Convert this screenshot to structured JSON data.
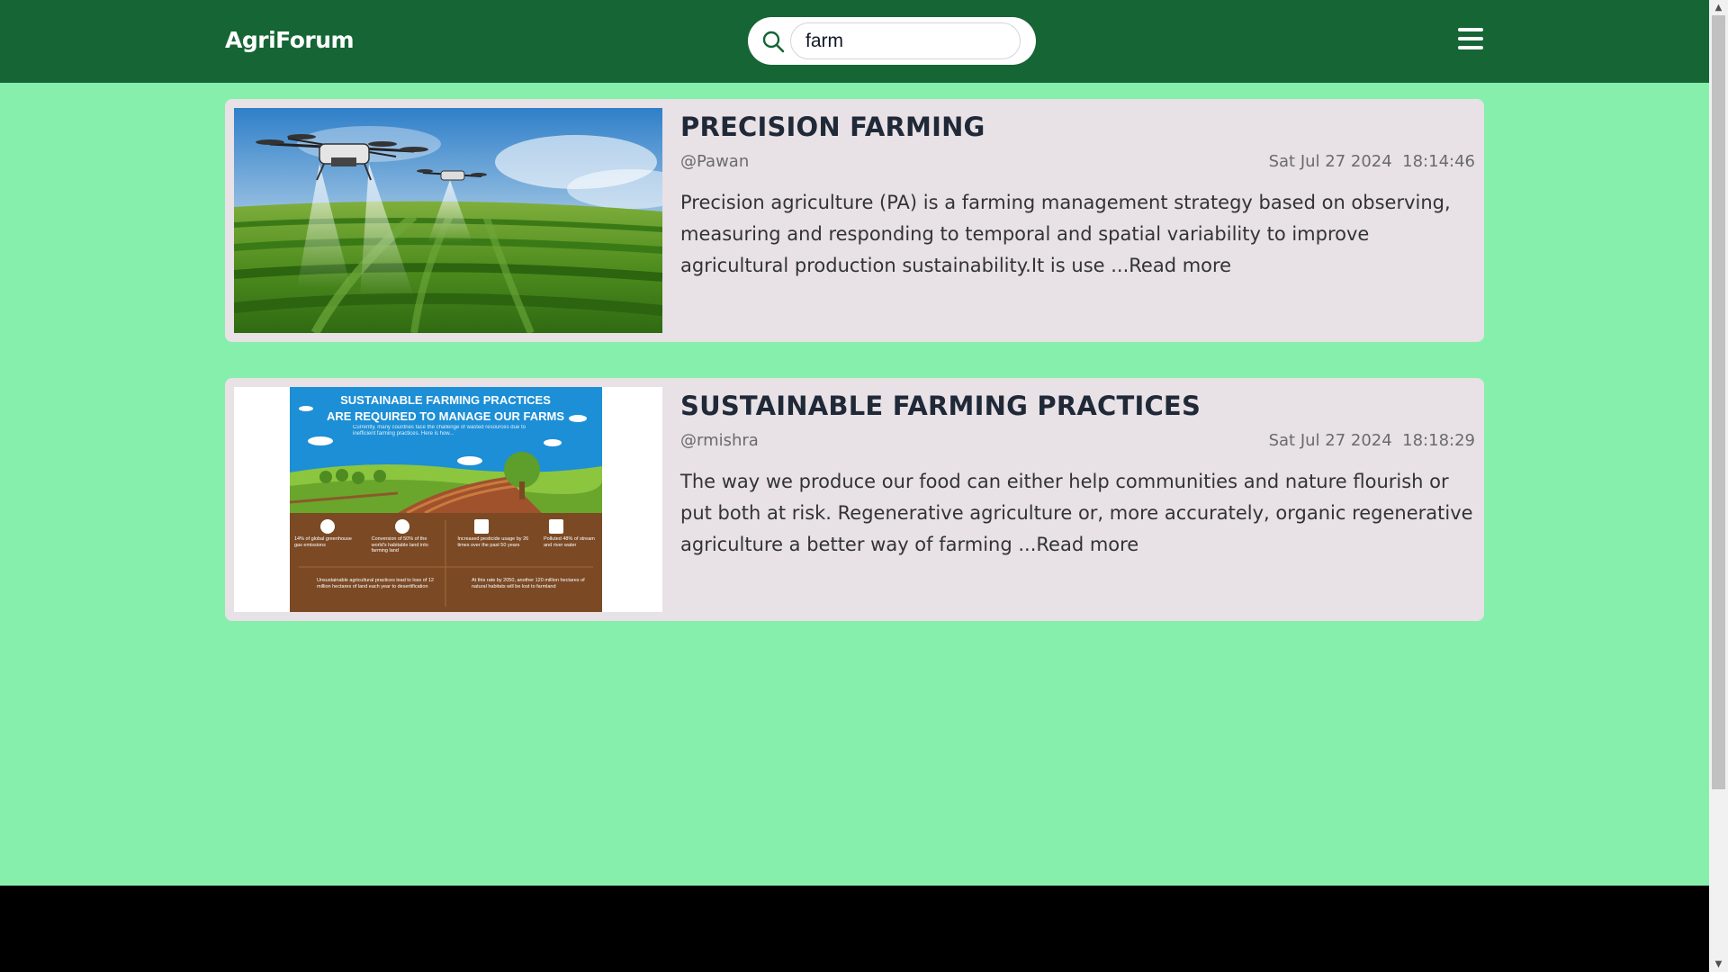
{
  "brand": "AgriForum",
  "search": {
    "value": "farm"
  },
  "posts": [
    {
      "title": "PRECISION FARMING",
      "author": "@Pawan",
      "date": "Sat Jul 27 2024",
      "time": "18:14:46",
      "excerpt": "Precision agriculture (PA) is a farming management strategy based on observing, measuring and responding to temporal and spatial variability to improve agricultural production sustainability.It is use ",
      "read_more": "...Read more"
    },
    {
      "title": "SUSTAINABLE FARMING PRACTICES",
      "author": "@rmishra",
      "date": "Sat Jul 27 2024",
      "time": "18:18:29",
      "excerpt": "The way we produce our food can either help communities and nature flourish or put both at risk. Regenerative agriculture or, more accurately, organic regenerative agriculture a better way of farming ",
      "read_more": "...Read more",
      "infographic": {
        "heading_line1": "SUSTAINABLE FARMING PRACTICES",
        "heading_line2": "ARE REQUIRED TO MANAGE OUR FARMS",
        "subheading": "Currently, many countries face the challenge of wasted resources due to inefficient farming practices. Here is how...",
        "stats": [
          {
            "text": "14% of global greenhouse gas emissions"
          },
          {
            "text": "Conversion of 50% of the world's habitable land into farming land"
          },
          {
            "text": "Increased pesticide usage by 26 times over the past 50 years"
          },
          {
            "text": "Polluted 48% of stream and river water"
          }
        ],
        "bottom_left": "Unsustainable agricultural practices lead to loss of 12 million hectares of land each year to desertification",
        "bottom_right": "At this rate by 2050, another 120 million hectares of natural habitats will be lost to farmland"
      }
    }
  ],
  "colors": {
    "navbar": "#166534",
    "page_background": "#86efac",
    "card_background": "#e8e1e6"
  }
}
